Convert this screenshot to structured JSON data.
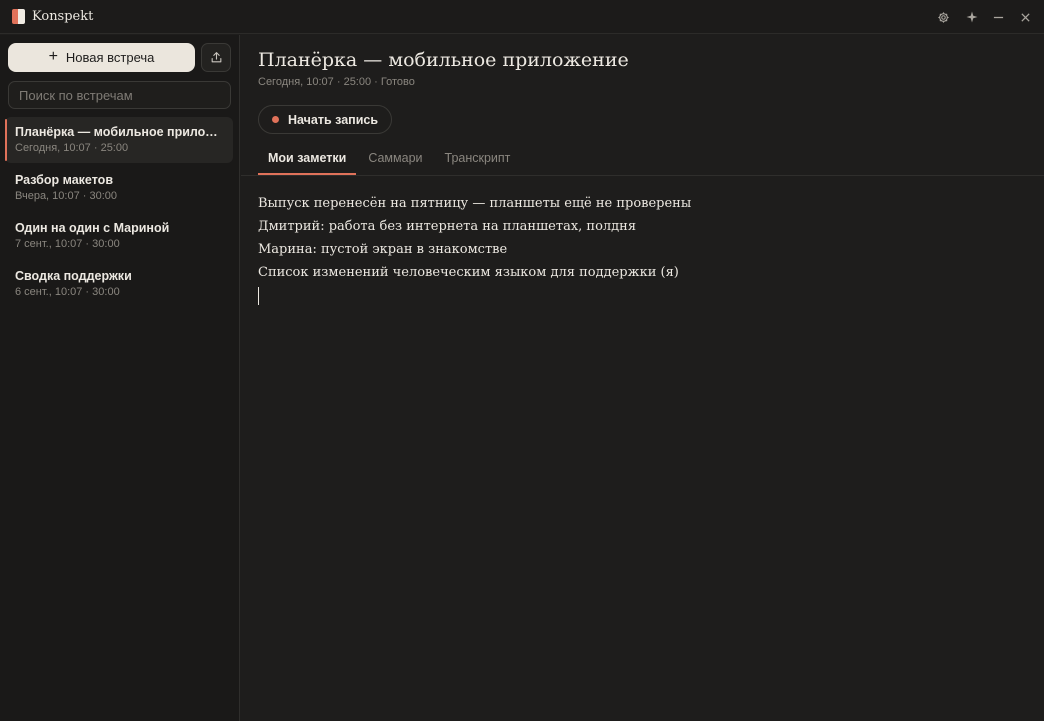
{
  "app": {
    "title": "Konspekt"
  },
  "sidebar": {
    "new_button_label": "Новая встреча",
    "search_placeholder": "Поиск по встречам",
    "meetings": [
      {
        "title": "Планёрка — мобильное прилож...",
        "meta": "Сегодня, 10:07 · 25:00",
        "active": true
      },
      {
        "title": "Разбор макетов",
        "meta": "Вчера, 10:07 · 30:00",
        "active": false
      },
      {
        "title": "Один на один с Мариной",
        "meta": "7 сент., 10:07 · 30:00",
        "active": false
      },
      {
        "title": "Сводка поддержки",
        "meta": "6 сент., 10:07 · 30:00",
        "active": false
      }
    ]
  },
  "main": {
    "title": "Планёрка — мобильное приложение",
    "meta": "Сегодня, 10:07 · 25:00 · Готово",
    "record_label": "Начать запись",
    "tabs": [
      {
        "label": "Мои заметки",
        "active": true
      },
      {
        "label": "Саммари",
        "active": false
      },
      {
        "label": "Транскрипт",
        "active": false
      }
    ],
    "notes": [
      "Выпуск перенесён на пятницу — планшеты ещё не проверены",
      "Дмитрий: работа без интернета на планшетах, полдня",
      "Марина: пустой экран в знакомстве",
      "Список изменений человеческим языком для поддержки (я)"
    ]
  },
  "icons": {
    "settings": "gear-icon",
    "sparkle": "sparkle-icon",
    "minimize": "minimize-icon",
    "close": "close-icon",
    "export": "upload-icon",
    "plus": "plus-icon"
  },
  "colors": {
    "accent": "#e0725a",
    "background": "#1e1d1c",
    "sidebar": "#1a1918"
  }
}
